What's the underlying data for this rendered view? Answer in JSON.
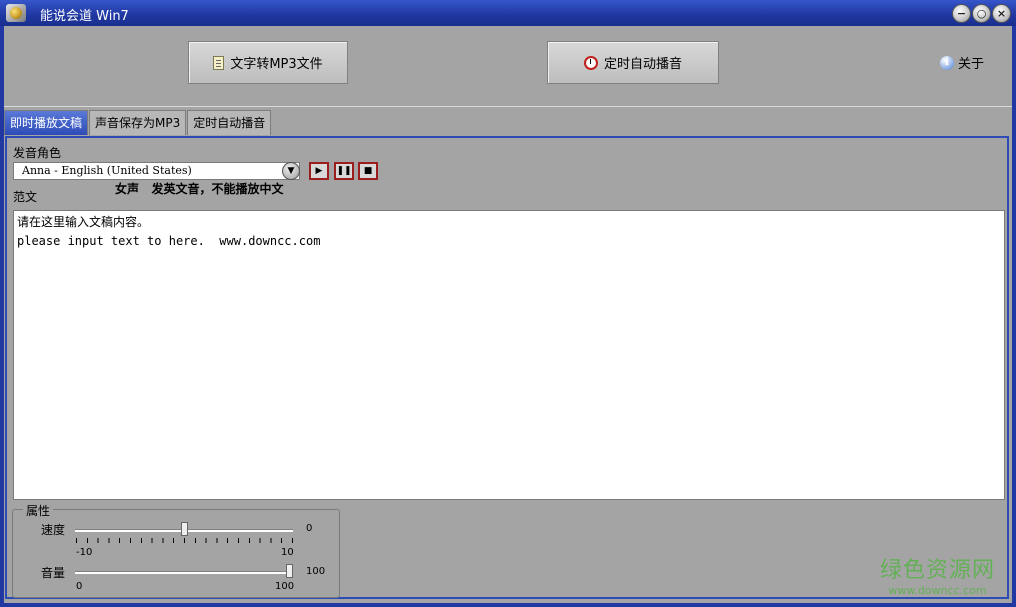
{
  "window": {
    "title": "能说会道 Win7",
    "buttons": {
      "minimize": "−",
      "maximize": "○",
      "close": "×"
    }
  },
  "toolbar": {
    "text_to_mp3": "文字转MP3文件",
    "scheduled_play": "定时自动播音",
    "about": "关于"
  },
  "tabs": [
    {
      "label": "即时播放文稿",
      "active": true
    },
    {
      "label": "声音保存为MP3",
      "active": false
    },
    {
      "label": "定时自动播音",
      "active": false
    }
  ],
  "voice": {
    "label": "发音角色",
    "selected": "Anna - English (United States)",
    "description": "女声   发英文音，不能播放中文"
  },
  "controls": {
    "play": "▶",
    "pause": "❚❚",
    "stop": "■"
  },
  "text": {
    "label": "范文",
    "content": "请在这里输入文稿内容。\nplease input text to here.  www.downcc.com"
  },
  "properties": {
    "title": "属性",
    "speed": {
      "label": "速度",
      "value": "0",
      "min": "-10",
      "max": "10",
      "level": 0.5
    },
    "volume": {
      "label": "音量",
      "value": "100",
      "min": "0",
      "max": "100",
      "level": 1.0
    }
  },
  "watermark": {
    "line1": "绿色资源网",
    "line2": "www.downcc.com"
  },
  "colors": {
    "accent": "#2d4bb5",
    "titlebar": "#2138a3",
    "panel": "#a4a4a4"
  }
}
